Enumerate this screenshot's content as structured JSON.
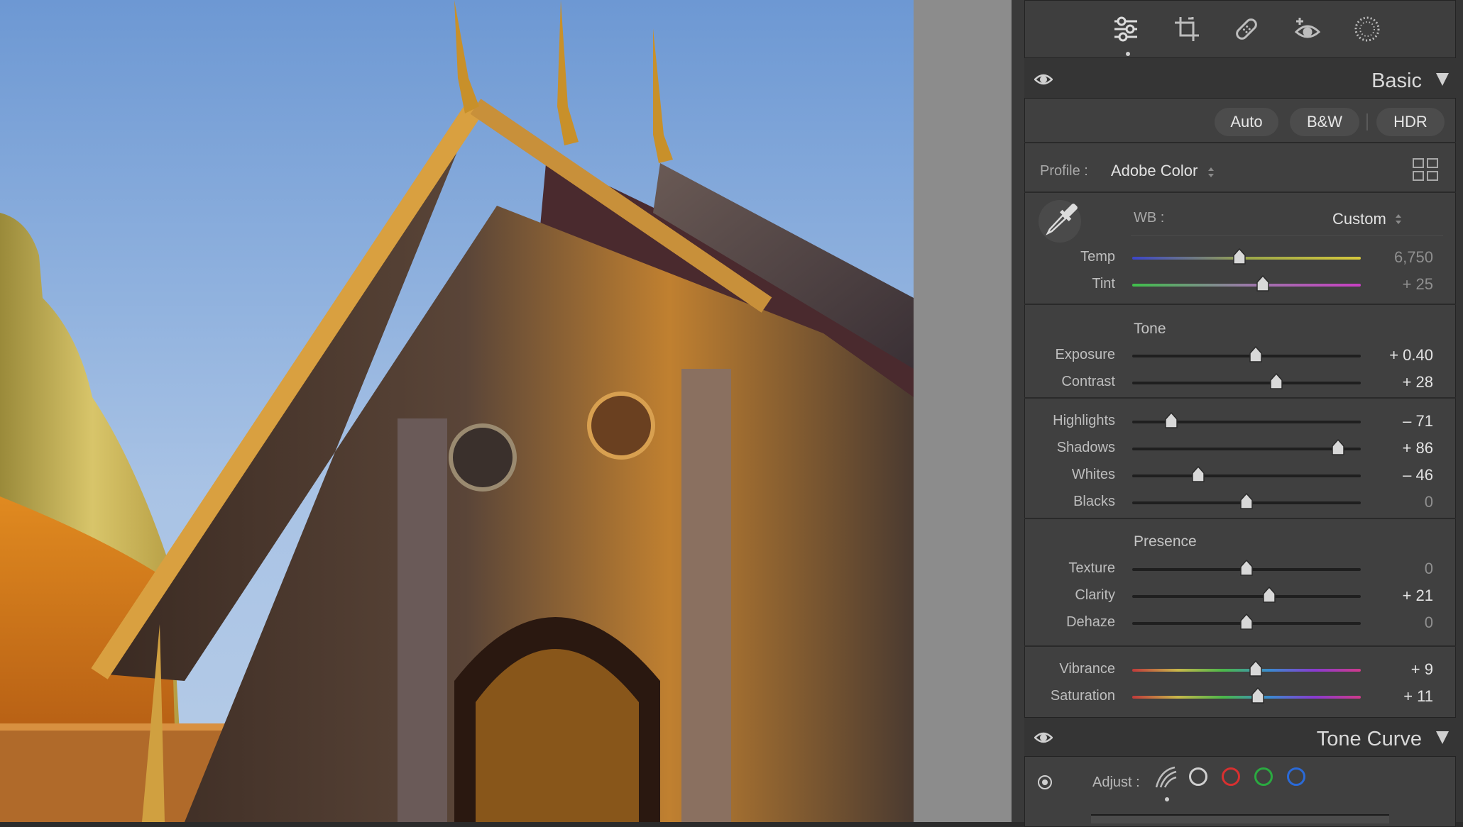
{
  "panel": {
    "tools": [
      "edit-sliders",
      "crop",
      "healing",
      "red-eye",
      "masking"
    ],
    "basic": {
      "title": "Basic",
      "buttons": {
        "auto": "Auto",
        "bw": "B&W",
        "hdr": "HDR"
      },
      "profile_label": "Profile :",
      "profile_value": "Adobe Color",
      "wb_label": "WB :",
      "wb_value": "Custom",
      "wb_rows": [
        {
          "label": "Temp",
          "value": "6,750",
          "position": 0.47,
          "dim": true,
          "track": "temp"
        },
        {
          "label": "Tint",
          "value": "+ 25",
          "position": 0.57,
          "dim": true,
          "track": "tint"
        }
      ],
      "tone_heading": "Tone",
      "tone_rows_a": [
        {
          "label": "Exposure",
          "value": "+ 0.40",
          "position": 0.54
        },
        {
          "label": "Contrast",
          "value": "+ 28",
          "position": 0.63
        }
      ],
      "tone_rows_b": [
        {
          "label": "Highlights",
          "value": "– 71",
          "position": 0.17
        },
        {
          "label": "Shadows",
          "value": "+ 86",
          "position": 0.9
        },
        {
          "label": "Whites",
          "value": "– 46",
          "position": 0.29
        },
        {
          "label": "Blacks",
          "value": "0",
          "position": 0.5,
          "dim": true
        }
      ],
      "presence_heading": "Presence",
      "presence_rows": [
        {
          "label": "Texture",
          "value": "0",
          "position": 0.5,
          "dim": true
        },
        {
          "label": "Clarity",
          "value": "+ 21",
          "position": 0.6
        },
        {
          "label": "Dehaze",
          "value": "0",
          "position": 0.5,
          "dim": true
        }
      ],
      "color_rows": [
        {
          "label": "Vibrance",
          "value": "+ 9",
          "position": 0.54,
          "track": "spectrum"
        },
        {
          "label": "Saturation",
          "value": "+ 11",
          "position": 0.55,
          "track": "spectrum"
        }
      ]
    },
    "tone_curve": {
      "title": "Tone Curve",
      "adjust_label": "Adjust :",
      "channels": [
        "parametric",
        "point",
        "red",
        "green",
        "blue"
      ]
    },
    "colors": {
      "temp_track": [
        "#3b45c9",
        "#9aa64a",
        "#d6c83c"
      ],
      "tint_track": [
        "#3fbf4a",
        "#9a7aa8",
        "#c83fc3"
      ],
      "spectrum": [
        "#c03a3a",
        "#c8b84a",
        "#4ab84a",
        "#3a8ad0",
        "#8a3ad0",
        "#d03a8a"
      ]
    }
  }
}
